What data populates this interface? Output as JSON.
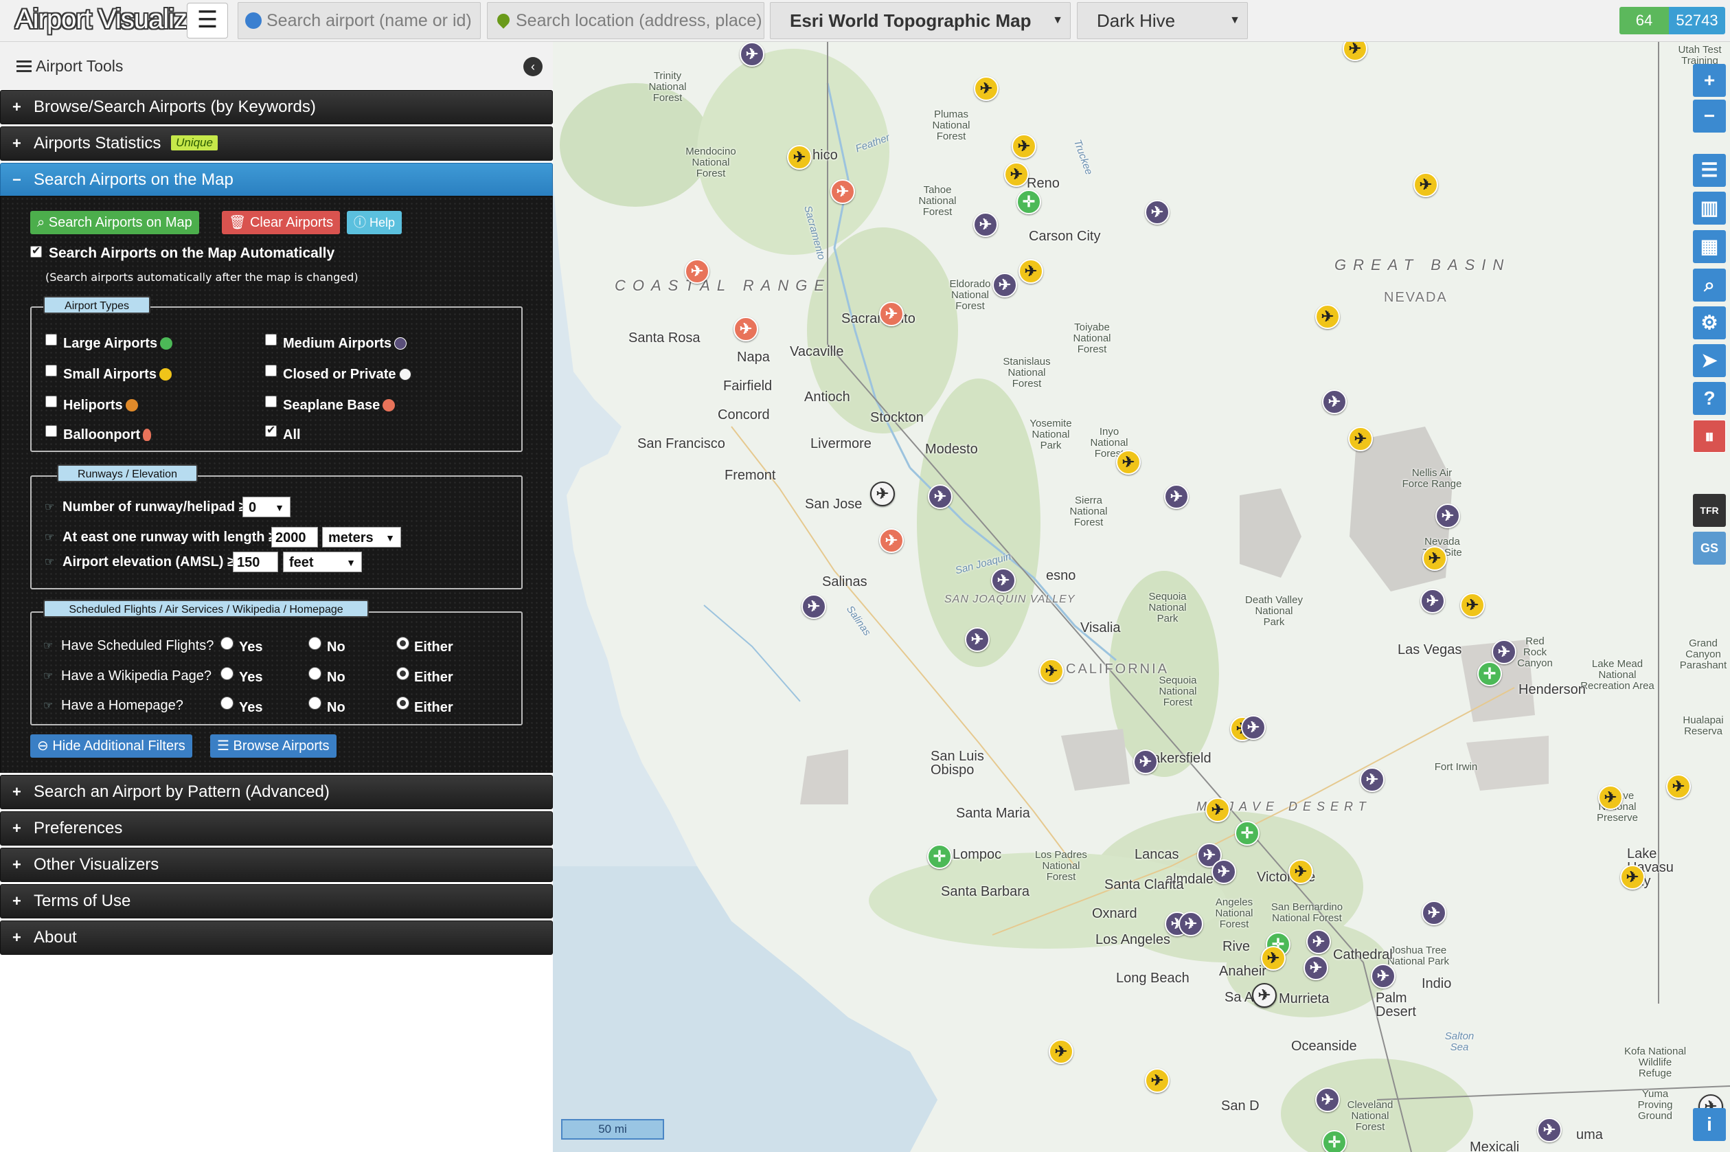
{
  "topbar": {
    "title": "Airport Visualizer",
    "search_airport_placeholder": "Search airport (name or id)",
    "search_location_placeholder": "Search location (address, place)",
    "map_layer": "Esri World Topographic Map",
    "theme": "Dark Hive",
    "count_visible": "64",
    "count_total": "52743"
  },
  "sidebar": {
    "header": "Airport Tools",
    "sections": [
      {
        "label": "Browse/Search Airports (by Keywords)"
      },
      {
        "label": "Airports Statistics",
        "badge": "Unique"
      },
      {
        "label": "Search Airports on the Map",
        "expanded": true
      },
      {
        "label": "Search an Airport by Pattern (Advanced)"
      },
      {
        "label": "Preferences"
      },
      {
        "label": "Other Visualizers"
      },
      {
        "label": "Terms of Use"
      },
      {
        "label": "About"
      }
    ],
    "panel": {
      "btn_search": "Search Airports on Map",
      "btn_clear": "Clear Airports",
      "btn_help": "Help",
      "auto_label": "Search Airports on the Map Automatically",
      "auto_checked": true,
      "auto_note": "(Search airports automatically after the map is changed)",
      "types_legend": "Airport Types",
      "types": [
        {
          "label": "Large Airports",
          "checked": false
        },
        {
          "label": "Medium Airports",
          "checked": false
        },
        {
          "label": "Small Airports",
          "checked": false
        },
        {
          "label": "Closed or Private",
          "checked": false
        },
        {
          "label": "Heliports",
          "checked": false
        },
        {
          "label": "Seaplane Base",
          "checked": false
        },
        {
          "label": "Balloonport",
          "checked": false
        },
        {
          "label": "All",
          "checked": true
        }
      ],
      "runways_legend": "Runways / Elevation",
      "runway_count_label": "Number of runway/helipad ≥",
      "runway_count_value": "0",
      "runway_length_label": "At east one runway with length ≥",
      "runway_length_value": "2000",
      "runway_length_unit": "meters",
      "elevation_label": "Airport elevation (AMSL) ≥",
      "elevation_value": "150",
      "elevation_unit": "feet",
      "flights_legend": "Scheduled Flights / Air Services / Wikipedia / Homepage",
      "questions": [
        {
          "label": "Have Scheduled Flights?",
          "selected": "Either"
        },
        {
          "label": "Have a Wikipedia Page?",
          "selected": "Either"
        },
        {
          "label": "Have a Homepage?",
          "selected": "Either"
        }
      ],
      "opt_yes": "Yes",
      "opt_no": "No",
      "opt_either": "Either",
      "btn_hide_filters": "Hide Additional Filters",
      "btn_browse": "Browse Airports"
    }
  },
  "map": {
    "scale": "50 mi",
    "tfr": "TFR",
    "labels": {
      "coastal_range": "COASTAL RANGE",
      "great_basin": "GREAT BASIN",
      "nevada": "NEVADA",
      "california": "CALIFORNIA",
      "san_joaquin_valley": "SAN JOAQUIN VALLEY",
      "mojave_desert": "MOJAVE DESERT",
      "trinity_nf": "Trinity National Forest",
      "mendocino_nf": "Mendocino National Forest",
      "plumas_nf": "Plumas National Forest",
      "tahoe_nf": "Tahoe National Forest",
      "eldorado_nf": "Eldorado National Forest",
      "stanislaus_nf": "Stanislaus National Forest",
      "toiyabe_nf": "Toiyabe National Forest",
      "yosemite_np": "Yosemite National Park",
      "inyo_nf": "Inyo National Forest",
      "sierra_nf": "Sierra National Forest",
      "sequoia_np": "Sequoia National Park",
      "sequoia_nf": "Sequoia National Forest",
      "death_valley_np": "Death Valley National Park",
      "nellis_range": "Nellis Air Force Range",
      "nevada_test_site": "Nevada Test Site",
      "red_rock": "Red Rock Canyon",
      "lake_mead": "Lake Mead National Recreation Area",
      "grand_canyon": "Grand Canyon Parashant",
      "hualapai": "Hualapai Reserva",
      "mojave_preserve": "Mojave National Preserve",
      "fort_irwin": "Fort Irwin",
      "los_padres_nf": "Los Padres National Forest",
      "angeles_nf": "Angeles National Forest",
      "san_bernardino_nf": "San Bernardino National Forest",
      "joshua_tree_np": "Joshua Tree National Park",
      "cleveland_nf": "Cleveland National Forest",
      "kofa_refuge": "Kofa National Wildlife Refuge",
      "yuma_proving": "Yuma Proving Ground",
      "salton_sea": "Salton Sea",
      "utah_test": "Utah Test Training",
      "feather": "Feather",
      "sacramento_river": "Sacramento",
      "truckee": "Truckee",
      "san_joaquin": "San Joaquin",
      "salinas_river": "Salinas"
    },
    "cities": {
      "chico": "hico",
      "reno": "Reno",
      "carson_city": "Carson City",
      "sacramento": "Sacramento",
      "santa_rosa": "Santa Rosa",
      "napa": "Napa",
      "vacaville": "Vacaville",
      "fairfield": "Fairfield",
      "antioch": "Antioch",
      "concord": "Concord",
      "stockton": "Stockton",
      "san_francisco": "San Francisco",
      "livermore": "Livermore",
      "modesto": "Modesto",
      "fremont": "Fremont",
      "san_jose": "San Jose",
      "salinas": "Salinas",
      "fresno": "esno",
      "visalia": "Visalia",
      "las_vegas": "Las Vegas",
      "henderson": "Henderson",
      "san_luis_obispo": "San Luis Obispo",
      "bakersfield": "akersfield",
      "santa_maria": "Santa Maria",
      "lompoc": "Lompoc",
      "santa_barbara": "Santa Barbara",
      "lancaster": "Lancas",
      "palmdale": "almdale",
      "victorville": "Victorville",
      "santa_clarita": "Santa Clarita",
      "oxnard": "Oxnard",
      "los_angeles": "Los Angeles",
      "riverside": "Rive",
      "anaheim": "Anaheir",
      "long_beach": "Long Beach",
      "santa_ana": "Sa Ana",
      "murrieta": "Murrieta",
      "palm_desert": "Palm Desert",
      "cathedral": "Cathedral",
      "indio": "Indio",
      "oceanside": "Oceanside",
      "san_diego": "San D",
      "lake_havasu": "Lake Havasu City",
      "mexicali": "Mexicali",
      "yuma": "uma"
    }
  }
}
